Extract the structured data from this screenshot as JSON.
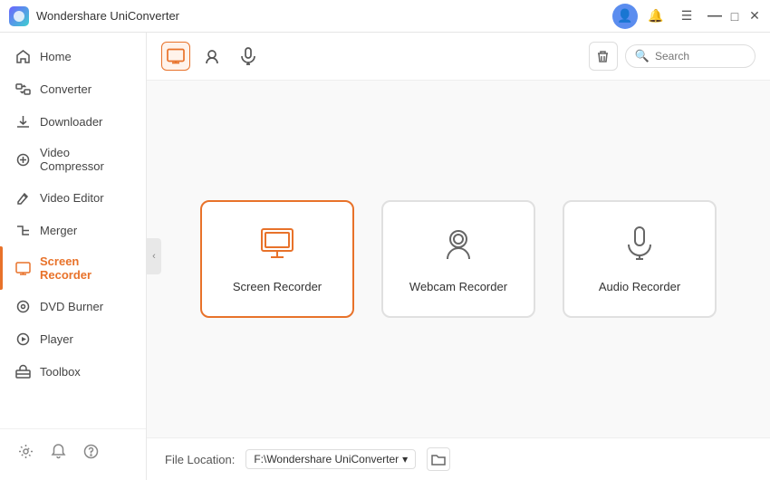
{
  "app": {
    "title": "Wondershare UniConverter",
    "logo_color": "#6c63ff"
  },
  "titlebar": {
    "title": "Wondershare UniConverter",
    "user_icon": "👤",
    "bell_icon": "🔔",
    "menu_icon": "☰",
    "min_icon": "—",
    "max_icon": "□",
    "close_icon": "✕"
  },
  "sidebar": {
    "items": [
      {
        "id": "home",
        "label": "Home",
        "icon": "home"
      },
      {
        "id": "converter",
        "label": "Converter",
        "icon": "converter"
      },
      {
        "id": "downloader",
        "label": "Downloader",
        "icon": "downloader"
      },
      {
        "id": "video-compressor",
        "label": "Video Compressor",
        "icon": "compress"
      },
      {
        "id": "video-editor",
        "label": "Video Editor",
        "icon": "edit"
      },
      {
        "id": "merger",
        "label": "Merger",
        "icon": "merge"
      },
      {
        "id": "screen-recorder",
        "label": "Screen Recorder",
        "icon": "screen",
        "active": true
      },
      {
        "id": "dvd-burner",
        "label": "DVD Burner",
        "icon": "dvd"
      },
      {
        "id": "player",
        "label": "Player",
        "icon": "play"
      },
      {
        "id": "toolbox",
        "label": "Toolbox",
        "icon": "toolbox"
      }
    ],
    "bottom_icons": [
      "settings",
      "bell",
      "help"
    ]
  },
  "toolbar": {
    "tab_screen": "screen-recorder-tab",
    "tab_webcam": "webcam-tab",
    "tab_audio": "audio-tab",
    "search_placeholder": "Search",
    "delete_tooltip": "Delete"
  },
  "recorder_cards": [
    {
      "id": "screen-recorder",
      "label": "Screen Recorder",
      "selected": true
    },
    {
      "id": "webcam-recorder",
      "label": "Webcam Recorder",
      "selected": false
    },
    {
      "id": "audio-recorder",
      "label": "Audio Recorder",
      "selected": false
    }
  ],
  "bottom_bar": {
    "file_location_label": "File Location:",
    "file_path": "F:\\Wondershare UniConverter",
    "dropdown_arrow": "▾"
  }
}
